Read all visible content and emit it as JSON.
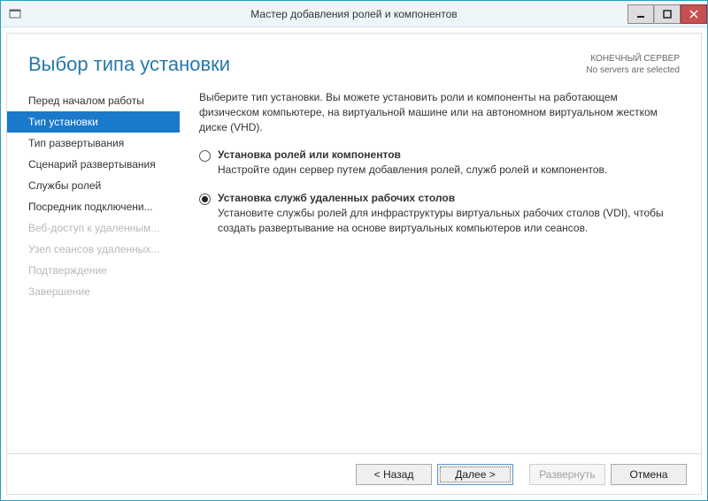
{
  "window": {
    "title": "Мастер добавления ролей и компонентов"
  },
  "header": {
    "page_title": "Выбор типа установки",
    "server_label": "КОНЕЧНЫЙ СЕРВЕР",
    "server_status": "No servers are selected"
  },
  "sidebar": {
    "items": [
      {
        "label": "Перед началом работы",
        "state": "normal"
      },
      {
        "label": "Тип установки",
        "state": "active"
      },
      {
        "label": "Тип развертывания",
        "state": "normal"
      },
      {
        "label": "Сценарий развертывания",
        "state": "normal"
      },
      {
        "label": "Службы ролей",
        "state": "normal"
      },
      {
        "label": "Посредник подключени...",
        "state": "normal"
      },
      {
        "label": "Веб-доступ к удаленным...",
        "state": "disabled"
      },
      {
        "label": "Узел сеансов удаленных...",
        "state": "disabled"
      },
      {
        "label": "Подтверждение",
        "state": "disabled"
      },
      {
        "label": "Завершение",
        "state": "disabled"
      }
    ]
  },
  "main": {
    "intro": "Выберите тип установки. Вы можете установить роли и компоненты на работающем физическом компьютере, на виртуальной машине или на автономном виртуальном жестком диске (VHD).",
    "options": [
      {
        "title": "Установка ролей или компонентов",
        "desc": "Настройте один сервер путем добавления ролей, служб ролей и компонентов.",
        "checked": false
      },
      {
        "title": "Установка служб удаленных рабочих столов",
        "desc": "Установите службы ролей для инфраструктуры виртуальных рабочих столов (VDI), чтобы создать развертывание на основе виртуальных компьютеров или сеансов.",
        "checked": true
      }
    ]
  },
  "buttons": {
    "back": "< Назад",
    "next": "Далее >",
    "deploy": "Развернуть",
    "cancel": "Отмена"
  }
}
